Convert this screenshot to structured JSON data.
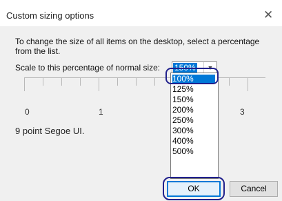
{
  "dialog": {
    "title": "Custom sizing options",
    "description": "To change the size of all items on the desktop, select a percentage from the list.",
    "scale_label": "Scale to this percentage of normal size:",
    "scale_value": "150%",
    "options": [
      "100%",
      "125%",
      "150%",
      "200%",
      "250%",
      "300%",
      "400%",
      "500%"
    ],
    "highlighted_option": "100%",
    "ruler_labels": [
      "0",
      "1",
      "3"
    ],
    "font_sample": "9 point Segoe UI.",
    "ok_label": "OK",
    "cancel_label": "Cancel",
    "close_glyph": "✕"
  },
  "colors": {
    "accent": "#0078d7",
    "annotation": "#20208c"
  },
  "icons": [
    "close-icon",
    "chevron-down-icon"
  ]
}
